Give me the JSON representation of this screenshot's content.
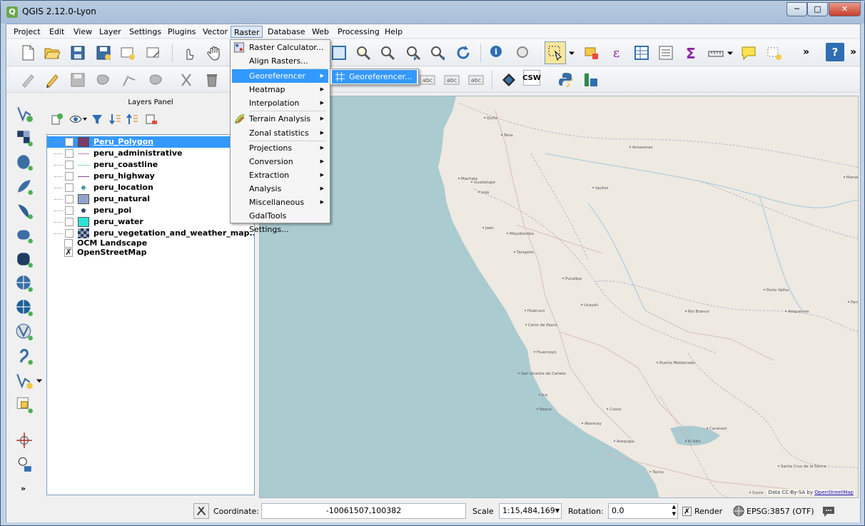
{
  "window": {
    "title": "QGIS 2.12.0-Lyon",
    "minimize": "─",
    "maximize": "□",
    "close": "✕"
  },
  "menubar": {
    "items": [
      "Project",
      "Edit",
      "View",
      "Layer",
      "Settings",
      "Plugins",
      "Vector",
      "Raster",
      "Database",
      "Web",
      "Processing",
      "Help"
    ]
  },
  "toolbar": {
    "overflow": "»",
    "help": "?",
    "csw_label": "CSW"
  },
  "layers_panel": {
    "title": "Layers Panel",
    "layers": [
      {
        "name": "Peru_Polygon",
        "checked": false,
        "symbol": "fill",
        "color": "#7a3b6a",
        "selected": true
      },
      {
        "name": "peru_administrative",
        "checked": false,
        "symbol": "line",
        "color": "#c08ac0"
      },
      {
        "name": "peru_coastline",
        "checked": false,
        "symbol": "line",
        "color": "#8ad0c0"
      },
      {
        "name": "peru_highway",
        "checked": false,
        "symbol": "line",
        "color": "#8a4a8a"
      },
      {
        "name": "peru_location",
        "checked": false,
        "symbol": "point",
        "color": "#4aa0a0"
      },
      {
        "name": "peru_natural",
        "checked": false,
        "symbol": "fill",
        "color": "#8fa4cc"
      },
      {
        "name": "peru_poi",
        "checked": false,
        "symbol": "point",
        "color": "#334477"
      },
      {
        "name": "peru_water",
        "checked": false,
        "symbol": "fill",
        "color": "#2ee0d6"
      },
      {
        "name": "peru_vegetation_and_weather_map...",
        "checked": false,
        "symbol": "raster",
        "color": "#2a3a55"
      },
      {
        "name": "OCM Landscape",
        "checked": false,
        "symbol": "none",
        "color": "",
        "root": true
      },
      {
        "name": "OpenStreetMap",
        "checked": true,
        "symbol": "none",
        "color": "",
        "root": true
      }
    ]
  },
  "raster_menu": {
    "items": [
      {
        "label": "Raster Calculator...",
        "submenu": false,
        "icon": "calculator-icon"
      },
      {
        "label": "Align Rasters...",
        "submenu": false,
        "icon": ""
      },
      {
        "label": "Georeferencer",
        "submenu": true,
        "highlighted": true
      },
      {
        "label": "Heatmap",
        "submenu": true
      },
      {
        "label": "Interpolation",
        "submenu": true
      },
      {
        "label": "Terrain Analysis",
        "submenu": true,
        "icon": "terrain-icon"
      },
      {
        "label": "Zonal statistics",
        "submenu": true
      },
      {
        "label": "Projections",
        "submenu": true
      },
      {
        "label": "Conversion",
        "submenu": true
      },
      {
        "label": "Extraction",
        "submenu": true
      },
      {
        "label": "Analysis",
        "submenu": true
      },
      {
        "label": "Miscellaneous",
        "submenu": true
      },
      {
        "label": "GdalTools Settings...",
        "submenu": false
      }
    ],
    "arrow": "▶"
  },
  "georef_submenu": {
    "item": "Georeferencer..."
  },
  "map": {
    "ocean_color": "#aacbd0",
    "land_color": "#eee9e1",
    "attribution_prefix": "Data CC-By-SA by ",
    "attribution_link": "OpenStreetMap",
    "cities": [
      {
        "name": "Quito"
      },
      {
        "name": "Tena"
      },
      {
        "name": "Machala"
      },
      {
        "name": "Guadalupe"
      },
      {
        "name": "Iquitos"
      },
      {
        "name": "Manaus"
      },
      {
        "name": "Loja"
      },
      {
        "name": "Jaén"
      },
      {
        "name": "Moyobamba"
      },
      {
        "name": "Tarapoto"
      },
      {
        "name": "Pucallpa"
      },
      {
        "name": "Porto Velho"
      },
      {
        "name": "Rio Branco"
      },
      {
        "name": "Ariquemes"
      },
      {
        "name": "Huánuco"
      },
      {
        "name": "Cerro de Pasco"
      },
      {
        "name": "Huancayo"
      },
      {
        "name": "San Vicente de Cañete"
      },
      {
        "name": "Puerto Maldonado"
      },
      {
        "name": "Ica"
      },
      {
        "name": "Nazca"
      },
      {
        "name": "Cusco"
      },
      {
        "name": "Abancay"
      },
      {
        "name": "Arequipa"
      },
      {
        "name": "El Alto"
      },
      {
        "name": "Santa Cruz de la Sierra"
      },
      {
        "name": "Tacna"
      },
      {
        "name": "Sucre"
      },
      {
        "name": "Caranavi"
      },
      {
        "name": "Ucayali"
      },
      {
        "name": "Amazonas"
      },
      {
        "name": "Pará"
      }
    ]
  },
  "statusbar": {
    "coordinate_label": "Coordinate:",
    "coordinate_value": "-10061507,100382",
    "scale_label": "Scale",
    "scale_value": "1:15,484,169",
    "rotation_label": "Rotation:",
    "rotation_value": "0.0",
    "render_label": "Render",
    "render_checked": true,
    "crs_label": "EPSG:3857 (OTF)"
  }
}
